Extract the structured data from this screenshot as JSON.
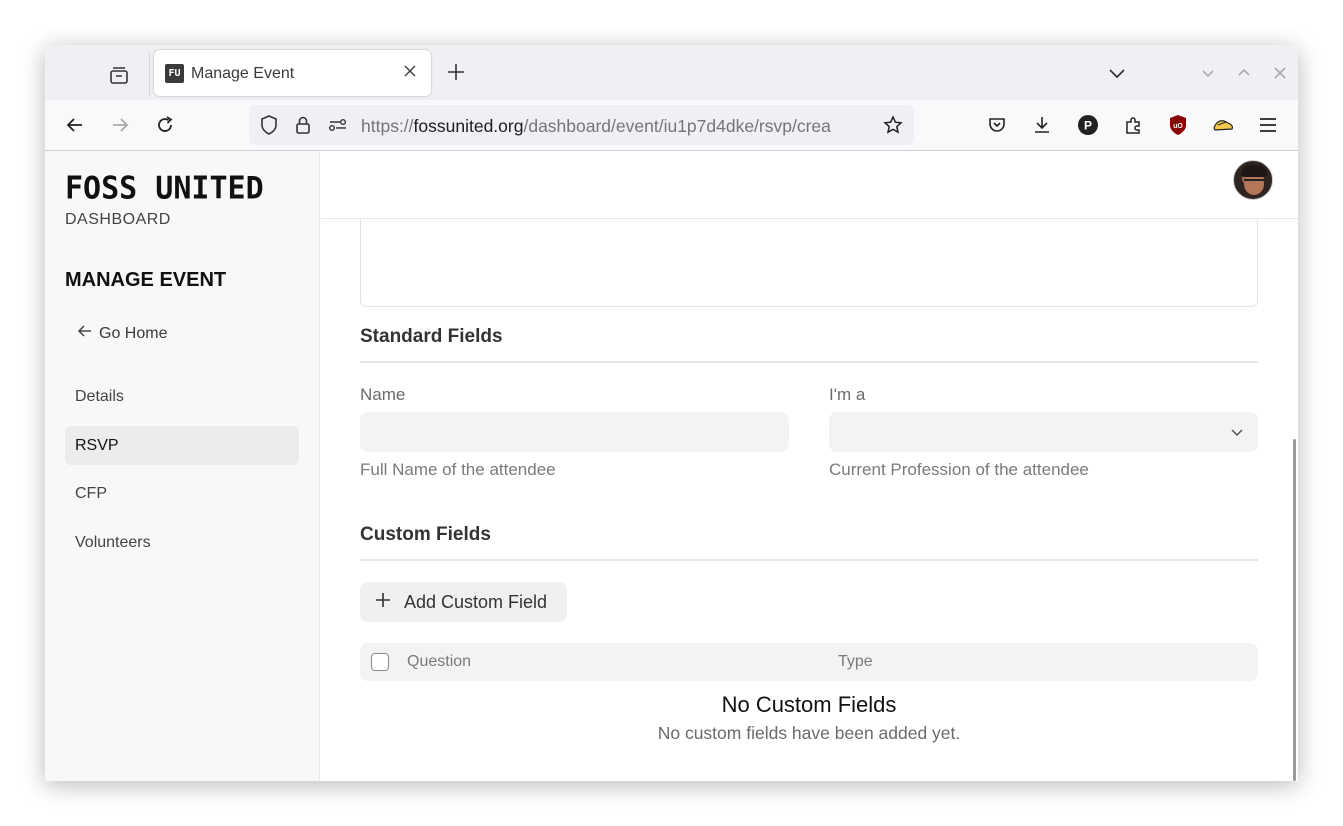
{
  "browser": {
    "tab_title": "Manage Event",
    "favicon_text": "FU",
    "url_prefix": "https://",
    "url_domain": "fossunited.org",
    "url_path": "/dashboard/event/iu1p7d4dke/rsvp/crea"
  },
  "sidebar": {
    "logo": "FOSS UNITED",
    "logo_sub": "DASHBOARD",
    "heading": "MANAGE EVENT",
    "go_home": "Go Home",
    "items": [
      {
        "label": "Details"
      },
      {
        "label": "RSVP",
        "active": true
      },
      {
        "label": "CFP"
      },
      {
        "label": "Volunteers"
      }
    ]
  },
  "main": {
    "standard_fields_title": "Standard Fields",
    "name_label": "Name",
    "name_value": "",
    "name_help": "Full Name of the attendee",
    "role_label": "I'm a",
    "role_value": "",
    "role_help": "Current Profession of the attendee",
    "custom_fields_title": "Custom Fields",
    "add_button": "Add Custom Field",
    "table_columns": [
      "Question",
      "Type"
    ],
    "empty_title": "No Custom Fields",
    "empty_sub": "No custom fields have been added yet."
  },
  "colors": {
    "active_bg": "#ececec",
    "ublock_red": "#8b0000"
  }
}
